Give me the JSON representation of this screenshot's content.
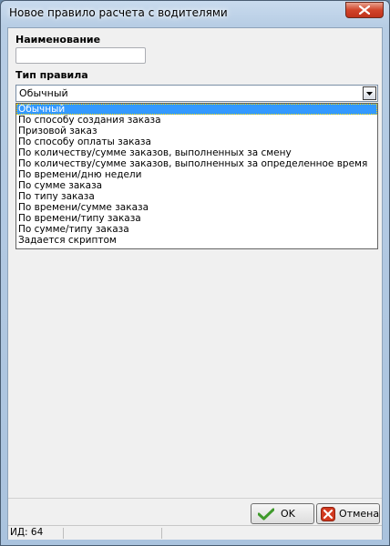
{
  "window": {
    "title": "Новое правило расчета с водителями"
  },
  "form": {
    "name_label": "Наименование",
    "name_value": "",
    "rule_type_label": "Тип правила",
    "rule_type_value": "Обычный"
  },
  "dropdown": {
    "options": [
      "Обычный",
      "По способу создания заказа",
      "Призовой заказ",
      "По способу оплаты заказа",
      "По количеству/сумме заказов, выполненных за смену",
      "По количеству/сумме заказов, выполненных за определенное время",
      "По времени/дню недели",
      "По сумме заказа",
      "По типу заказа",
      "По времени/сумме заказа",
      "По времени/типу заказа",
      "По сумме/типу заказа",
      "Задается скриптом"
    ],
    "selected_index": 0
  },
  "buttons": {
    "ok": "OK",
    "cancel": "Отмена"
  },
  "status": {
    "id_text": "ИД: 64"
  },
  "colors": {
    "selection": "#3399ff",
    "close": "#d1442a"
  }
}
